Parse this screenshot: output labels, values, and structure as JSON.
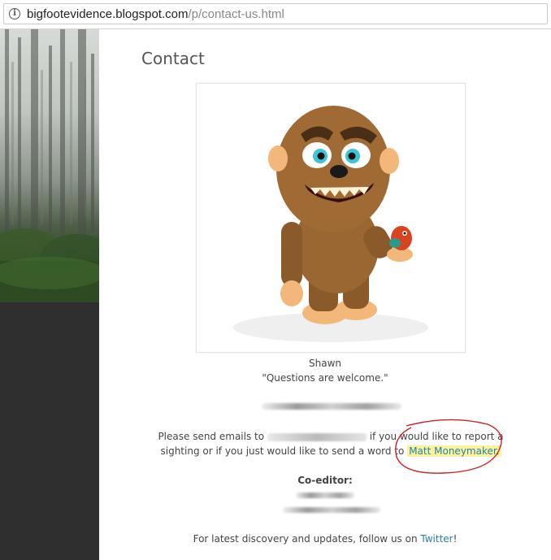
{
  "browser": {
    "url_domain": "bigfootevidence.blogspot.com",
    "url_path": "/p/contact-us.html"
  },
  "page": {
    "title": "Contact",
    "caption_name": "Shawn",
    "caption_quote": "\"Questions are welcome.\"",
    "para_part1": "Please send emails to ",
    "para_part2": " if you would like to report a sighting or if you just would like to send a word to ",
    "para_link": "Matt Moneymaker.",
    "coeditor_label": "Co-editor:",
    "follow_text": "For latest discovery and updates, follow us on ",
    "follow_link": "Twitter",
    "follow_end": "!"
  },
  "colors": {
    "link": "#2a7fb0",
    "highlight": "#f9f39b",
    "annotation": "#cc2222",
    "sidebar_dark": "#2f2f2f"
  },
  "icons": {
    "info": "info-circle-icon"
  }
}
